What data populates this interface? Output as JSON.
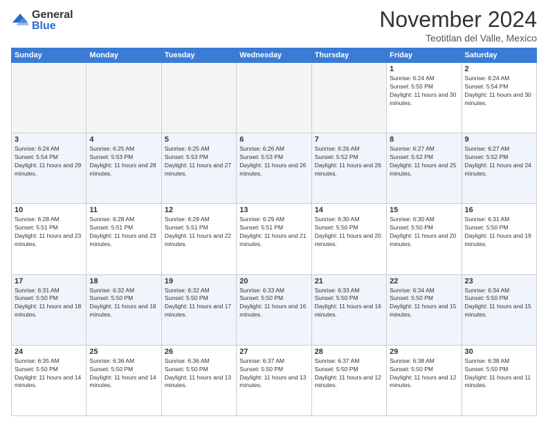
{
  "logo": {
    "general": "General",
    "blue": "Blue"
  },
  "header": {
    "month": "November 2024",
    "location": "Teotitlan del Valle, Mexico"
  },
  "weekdays": [
    "Sunday",
    "Monday",
    "Tuesday",
    "Wednesday",
    "Thursday",
    "Friday",
    "Saturday"
  ],
  "weeks": [
    [
      {
        "day": "",
        "empty": true
      },
      {
        "day": "",
        "empty": true
      },
      {
        "day": "",
        "empty": true
      },
      {
        "day": "",
        "empty": true
      },
      {
        "day": "",
        "empty": true
      },
      {
        "day": "1",
        "sunrise": "6:24 AM",
        "sunset": "5:55 PM",
        "daylight": "11 hours and 30 minutes."
      },
      {
        "day": "2",
        "sunrise": "6:24 AM",
        "sunset": "5:54 PM",
        "daylight": "11 hours and 30 minutes."
      }
    ],
    [
      {
        "day": "3",
        "sunrise": "6:24 AM",
        "sunset": "5:54 PM",
        "daylight": "11 hours and 29 minutes."
      },
      {
        "day": "4",
        "sunrise": "6:25 AM",
        "sunset": "5:53 PM",
        "daylight": "11 hours and 28 minutes."
      },
      {
        "day": "5",
        "sunrise": "6:25 AM",
        "sunset": "5:53 PM",
        "daylight": "11 hours and 27 minutes."
      },
      {
        "day": "6",
        "sunrise": "6:26 AM",
        "sunset": "5:53 PM",
        "daylight": "11 hours and 26 minutes."
      },
      {
        "day": "7",
        "sunrise": "6:26 AM",
        "sunset": "5:52 PM",
        "daylight": "11 hours and 26 minutes."
      },
      {
        "day": "8",
        "sunrise": "6:27 AM",
        "sunset": "5:52 PM",
        "daylight": "11 hours and 25 minutes."
      },
      {
        "day": "9",
        "sunrise": "6:27 AM",
        "sunset": "5:52 PM",
        "daylight": "11 hours and 24 minutes."
      }
    ],
    [
      {
        "day": "10",
        "sunrise": "6:28 AM",
        "sunset": "5:51 PM",
        "daylight": "11 hours and 23 minutes."
      },
      {
        "day": "11",
        "sunrise": "6:28 AM",
        "sunset": "5:51 PM",
        "daylight": "11 hours and 23 minutes."
      },
      {
        "day": "12",
        "sunrise": "6:29 AM",
        "sunset": "5:51 PM",
        "daylight": "11 hours and 22 minutes."
      },
      {
        "day": "13",
        "sunrise": "6:29 AM",
        "sunset": "5:51 PM",
        "daylight": "11 hours and 21 minutes."
      },
      {
        "day": "14",
        "sunrise": "6:30 AM",
        "sunset": "5:50 PM",
        "daylight": "11 hours and 20 minutes."
      },
      {
        "day": "15",
        "sunrise": "6:30 AM",
        "sunset": "5:50 PM",
        "daylight": "11 hours and 20 minutes."
      },
      {
        "day": "16",
        "sunrise": "6:31 AM",
        "sunset": "5:50 PM",
        "daylight": "11 hours and 19 minutes."
      }
    ],
    [
      {
        "day": "17",
        "sunrise": "6:31 AM",
        "sunset": "5:50 PM",
        "daylight": "11 hours and 18 minutes."
      },
      {
        "day": "18",
        "sunrise": "6:32 AM",
        "sunset": "5:50 PM",
        "daylight": "11 hours and 18 minutes."
      },
      {
        "day": "19",
        "sunrise": "6:32 AM",
        "sunset": "5:50 PM",
        "daylight": "11 hours and 17 minutes."
      },
      {
        "day": "20",
        "sunrise": "6:33 AM",
        "sunset": "5:50 PM",
        "daylight": "11 hours and 16 minutes."
      },
      {
        "day": "21",
        "sunrise": "6:33 AM",
        "sunset": "5:50 PM",
        "daylight": "11 hours and 16 minutes."
      },
      {
        "day": "22",
        "sunrise": "6:34 AM",
        "sunset": "5:50 PM",
        "daylight": "11 hours and 15 minutes."
      },
      {
        "day": "23",
        "sunrise": "6:34 AM",
        "sunset": "5:50 PM",
        "daylight": "11 hours and 15 minutes."
      }
    ],
    [
      {
        "day": "24",
        "sunrise": "6:35 AM",
        "sunset": "5:50 PM",
        "daylight": "11 hours and 14 minutes."
      },
      {
        "day": "25",
        "sunrise": "6:36 AM",
        "sunset": "5:50 PM",
        "daylight": "11 hours and 14 minutes."
      },
      {
        "day": "26",
        "sunrise": "6:36 AM",
        "sunset": "5:50 PM",
        "daylight": "11 hours and 13 minutes."
      },
      {
        "day": "27",
        "sunrise": "6:37 AM",
        "sunset": "5:50 PM",
        "daylight": "11 hours and 13 minutes."
      },
      {
        "day": "28",
        "sunrise": "6:37 AM",
        "sunset": "5:50 PM",
        "daylight": "11 hours and 12 minutes."
      },
      {
        "day": "29",
        "sunrise": "6:38 AM",
        "sunset": "5:50 PM",
        "daylight": "11 hours and 12 minutes."
      },
      {
        "day": "30",
        "sunrise": "6:38 AM",
        "sunset": "5:50 PM",
        "daylight": "11 hours and 11 minutes."
      }
    ]
  ]
}
